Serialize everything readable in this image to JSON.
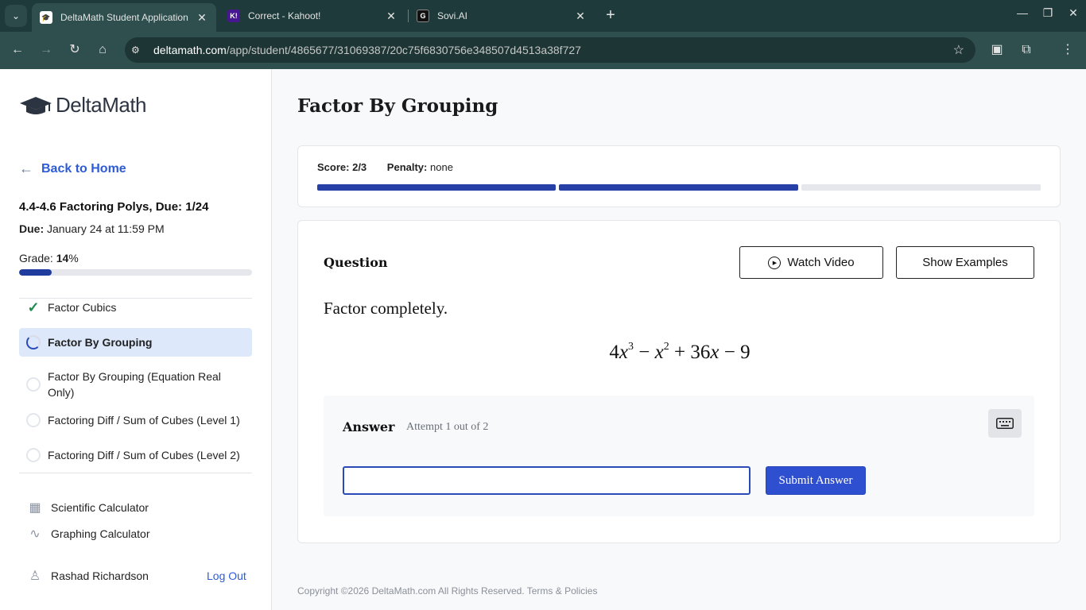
{
  "browser": {
    "tabs": [
      {
        "title": "DeltaMath Student Application",
        "active": true
      },
      {
        "title": "Correct - Kahoot!",
        "active": false
      },
      {
        "title": "Sovi.AI",
        "active": false
      }
    ],
    "url_host": "deltamath.com",
    "url_path": "/app/student/4865677/31069387/20c75f6830756e348507d4513a38f727"
  },
  "sidebar": {
    "logo_text": "DeltaMath",
    "back_label": "Back to Home",
    "assignment_title": "4.4-4.6 Factoring Polys, Due: 1/24",
    "due_label": "Due:",
    "due_value": "January 24 at 11:59 PM",
    "grade_label": "Grade:",
    "grade_value": "14",
    "grade_unit": "%",
    "grade_fraction": 0.14,
    "skills": [
      {
        "label": "Factor Cubics",
        "status": "complete"
      },
      {
        "label": "Factor By Grouping",
        "status": "in-progress"
      },
      {
        "label": "Factor By Grouping (Equation Real Only)",
        "status": "not-started"
      },
      {
        "label": "Factoring Diff / Sum of Cubes (Level 1)",
        "status": "not-started"
      },
      {
        "label": "Factoring Diff / Sum of Cubes (Level 2)",
        "status": "not-started"
      }
    ],
    "tools": [
      {
        "label": "Scientific Calculator",
        "icon": "calculator-icon"
      },
      {
        "label": "Graphing Calculator",
        "icon": "graph-icon"
      }
    ],
    "user_name": "Rashad Richardson",
    "logout_label": "Log Out"
  },
  "main": {
    "page_title": "Factor By Grouping",
    "score_label": "Score:",
    "score_value": "2/3",
    "penalty_label": "Penalty:",
    "penalty_value": "none",
    "progress_segments": [
      {
        "filled": true,
        "color": "#2640a8"
      },
      {
        "filled": true,
        "color": "#2640a8"
      },
      {
        "filled": false,
        "color": "#e5e7ec"
      }
    ],
    "question_label": "Question",
    "watch_video_label": "Watch Video",
    "show_examples_label": "Show Examples",
    "prompt": "Factor completely.",
    "expression": {
      "t1_coef": "4",
      "t1_var": "x",
      "t1_exp": "3",
      "op1": "−",
      "t2_var": "x",
      "t2_exp": "2",
      "op2": "+",
      "t3_coef": "36",
      "t3_var": "x",
      "op3": "−",
      "t4": "9"
    },
    "answer_label": "Answer",
    "attempt_text": "Attempt 1 out of 2",
    "answer_value": "",
    "submit_label": "Submit Answer",
    "footer_text": "Copyright ©2026 DeltaMath.com All Rights Reserved. Terms & Policies"
  },
  "colors": {
    "accent": "#2f4fd1",
    "link": "#2e5bd6",
    "progress": "#2640a8",
    "active_skill_bg": "#dde8fa",
    "check": "#1f8a4c"
  }
}
